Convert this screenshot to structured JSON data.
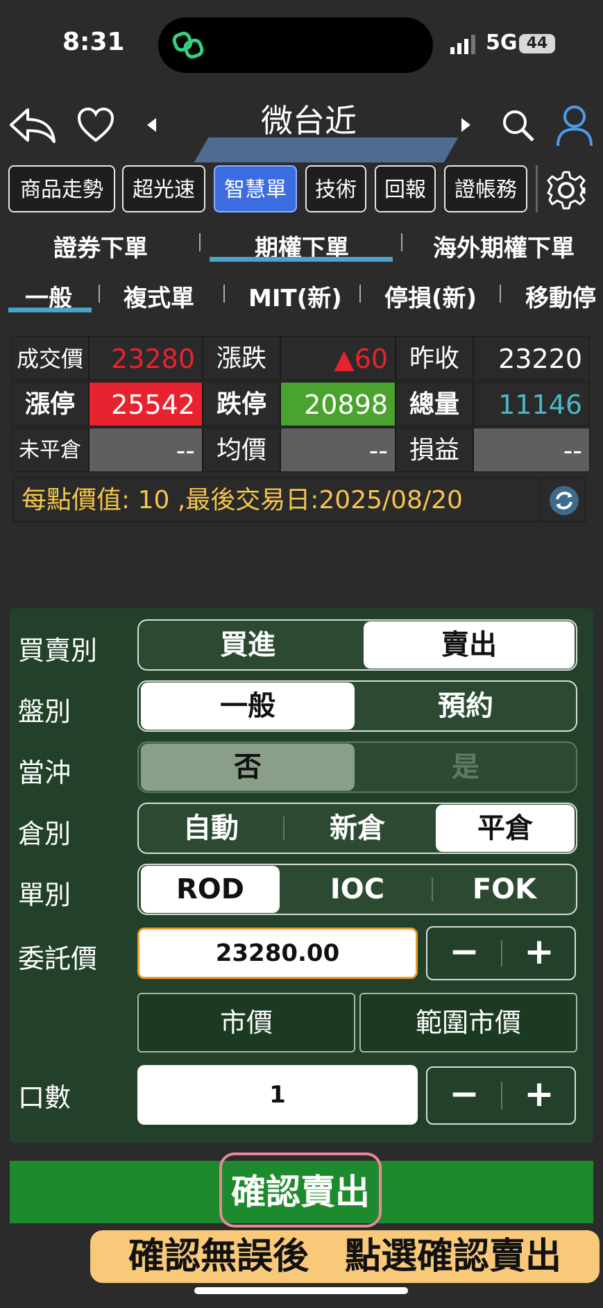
{
  "status": {
    "time": "8:31",
    "network": "5G",
    "battery": "44"
  },
  "header": {
    "title": "微台近"
  },
  "tabs": [
    "商品走勢",
    "超光速",
    "智慧單",
    "技術",
    "回報",
    "證帳務"
  ],
  "order_tabs": [
    "證券下單",
    "期權下單",
    "海外期權下單"
  ],
  "sub_tabs": [
    "一般",
    "複式單",
    "MIT(新)",
    "停損(新)",
    "移動停"
  ],
  "quote": {
    "last_label": "成交價",
    "last": "23280",
    "change_label": "漲跌",
    "change": "▲60",
    "prev_label": "昨收",
    "prev": "23220",
    "limit_up_label": "漲停",
    "limit_up": "25542",
    "limit_down_label": "跌停",
    "limit_down": "20898",
    "volume_label": "總量",
    "volume": "11146",
    "open_pos_label": "未平倉",
    "open_pos": "--",
    "avg_label": "均價",
    "avg": "--",
    "pnl_label": "損益",
    "pnl": "--",
    "info": "每點價值: 10 ,最後交易日:2025/08/20"
  },
  "order": {
    "side_label": "買賣別",
    "side_buy": "買進",
    "side_sell": "賣出",
    "session_label": "盤別",
    "session_normal": "一般",
    "session_reserve": "預約",
    "daytrade_label": "當沖",
    "daytrade_no": "否",
    "daytrade_yes": "是",
    "position_label": "倉別",
    "position_auto": "自動",
    "position_new": "新倉",
    "position_close": "平倉",
    "type_label": "單別",
    "type_rod": "ROD",
    "type_ioc": "IOC",
    "type_fok": "FOK",
    "price_label": "委託價",
    "price": "23280.00",
    "market": "市價",
    "range_market": "範圍市價",
    "qty_label": "口數",
    "qty": "1",
    "minus": "−",
    "plus": "+"
  },
  "confirm": {
    "label": "確認賣出"
  },
  "hint": "確認無誤後　點選確認賣出",
  "colors": {
    "up": "#e8232f",
    "down": "#4aa32e",
    "accent": "#4aa3c8",
    "info": "#f5c64a"
  }
}
